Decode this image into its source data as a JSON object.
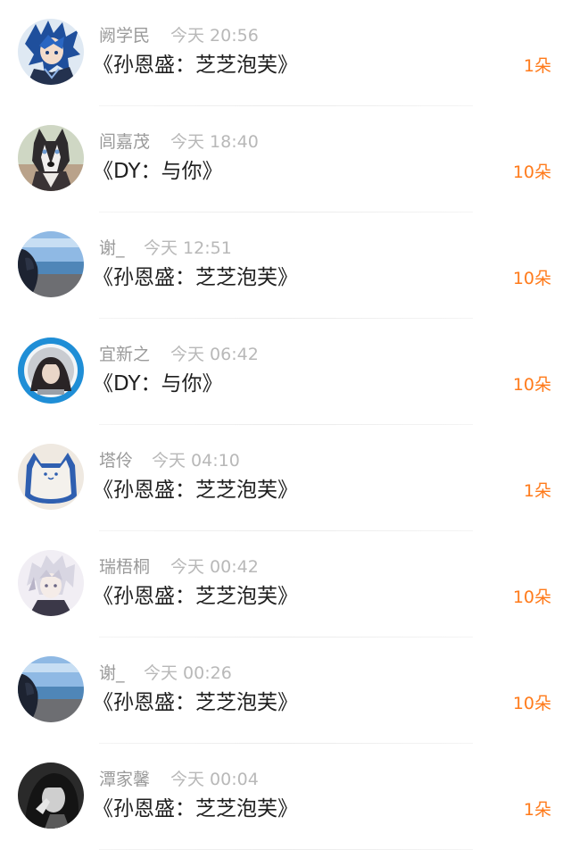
{
  "colors": {
    "name": "#9a9a9a",
    "time": "#b8b8b8",
    "song": "#1f1f1f",
    "gift": "#ff7a1a",
    "divider": "#ebebeb"
  },
  "entries": [
    {
      "name": "阙学民",
      "time": "今天 20:56",
      "song": "《孙恩盛：芝芝泡芙》",
      "gift": "1朵",
      "avatar_icon": "anime-boy-blue-hair-avatar"
    },
    {
      "name": "闾嘉茂",
      "time": "今天 18:40",
      "song": "《DY：与你》",
      "gift": "10朵",
      "avatar_icon": "husky-dog-avatar"
    },
    {
      "name": "谢_",
      "time": "今天 12:51",
      "song": "《孙恩盛：芝芝泡芙》",
      "gift": "10朵",
      "avatar_icon": "seaside-girl-avatar"
    },
    {
      "name": "宜新之",
      "time": "今天 06:42",
      "song": "《DY：与你》",
      "gift": "10朵",
      "avatar_icon": "girl-blue-ring-avatar"
    },
    {
      "name": "塔伶",
      "time": "今天 04:10",
      "song": "《孙恩盛：芝芝泡芙》",
      "gift": "1朵",
      "avatar_icon": "cat-cushion-avatar"
    },
    {
      "name": "瑞梧桐",
      "time": "今天 00:42",
      "song": "《孙恩盛：芝芝泡芙》",
      "gift": "10朵",
      "avatar_icon": "anime-boy-white-hair-avatar"
    },
    {
      "name": "谢_",
      "time": "今天 00:26",
      "song": "《孙恩盛：芝芝泡芙》",
      "gift": "10朵",
      "avatar_icon": "seaside-girl-avatar"
    },
    {
      "name": "潭家馨",
      "time": "今天 00:04",
      "song": "《孙恩盛：芝芝泡芙》",
      "gift": "1朵",
      "avatar_icon": "bw-girl-avatar"
    }
  ]
}
